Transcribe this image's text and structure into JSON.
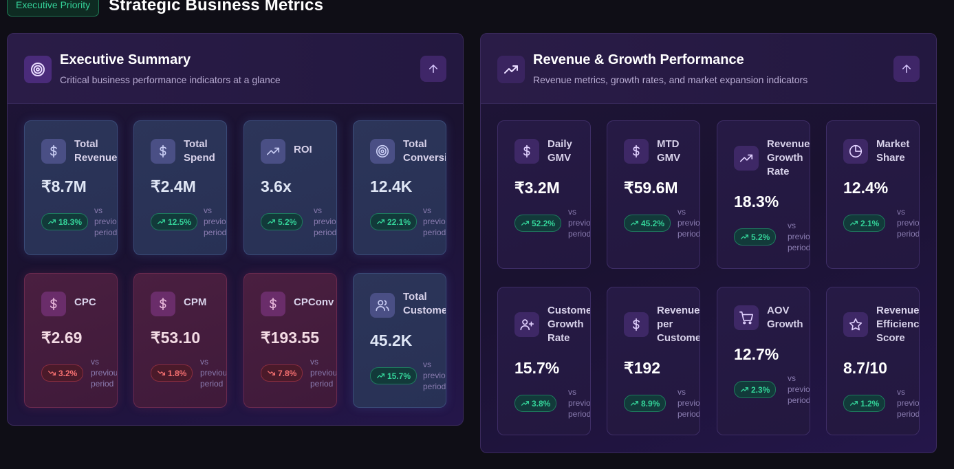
{
  "header": {
    "badge": "Executive Priority",
    "title": "Strategic Business Metrics"
  },
  "vs_text": "vs\nprevious\nperiod",
  "left_panel": {
    "title": "Executive Summary",
    "subtitle": "Critical business performance indicators at a glance",
    "cards": [
      {
        "label": "Total\nRevenue",
        "value": "₹8.7M",
        "change": "18.3%",
        "trend": "up",
        "icon": "dollar-icon",
        "tone": "blue"
      },
      {
        "label": "Total\nSpend",
        "value": "₹2.4M",
        "change": "12.5%",
        "trend": "up",
        "icon": "dollar-icon",
        "tone": "blue"
      },
      {
        "label": "ROI",
        "value": "3.6x",
        "change": "5.2%",
        "trend": "up",
        "icon": "trending-up-icon",
        "tone": "blue"
      },
      {
        "label": "Total\nConversions",
        "value": "12.4K",
        "change": "22.1%",
        "trend": "up",
        "icon": "target-icon",
        "tone": "blue"
      },
      {
        "label": "CPC",
        "value": "₹2.69",
        "change": "3.2%",
        "trend": "down",
        "icon": "dollar-icon",
        "tone": "red"
      },
      {
        "label": "CPM",
        "value": "₹53.10",
        "change": "1.8%",
        "trend": "down",
        "icon": "dollar-icon",
        "tone": "red"
      },
      {
        "label": "CPConv",
        "value": "₹193.55",
        "change": "7.8%",
        "trend": "down",
        "icon": "dollar-icon",
        "tone": "red"
      },
      {
        "label": "Total\nCustomers",
        "value": "45.2K",
        "change": "15.7%",
        "trend": "up",
        "icon": "users-icon",
        "tone": "blue"
      }
    ]
  },
  "right_panel": {
    "title": "Revenue & Growth Performance",
    "subtitle": "Revenue metrics, growth rates, and market expansion indicators",
    "cards": [
      {
        "label": "Daily\nGMV",
        "value": "₹3.2M",
        "change": "52.2%",
        "trend": "up",
        "icon": "dollar-icon",
        "tone": "purple"
      },
      {
        "label": "MTD\nGMV",
        "value": "₹59.6M",
        "change": "45.2%",
        "trend": "up",
        "icon": "dollar-icon",
        "tone": "purple"
      },
      {
        "label": "Revenue\nGrowth\nRate",
        "value": "18.3%",
        "change": "5.2%",
        "trend": "up",
        "icon": "trending-up-icon",
        "tone": "purple"
      },
      {
        "label": "Market\nShare",
        "value": "12.4%",
        "change": "2.1%",
        "trend": "up",
        "icon": "pie-chart-icon",
        "tone": "purple"
      },
      {
        "label": "Customer\nGrowth\nRate",
        "value": "15.7%",
        "change": "3.8%",
        "trend": "up",
        "icon": "user-plus-icon",
        "tone": "purple"
      },
      {
        "label": "Revenue\nper\nCustomer",
        "value": "₹192",
        "change": "8.9%",
        "trend": "up",
        "icon": "dollar-icon",
        "tone": "purple"
      },
      {
        "label": "AOV\nGrowth",
        "value": "12.7%",
        "change": "2.3%",
        "trend": "up",
        "icon": "cart-icon",
        "tone": "purple"
      },
      {
        "label": "Revenue\nEfficiency\nScore",
        "value": "8.7/10",
        "change": "1.2%",
        "trend": "up",
        "icon": "star-icon",
        "tone": "purple"
      }
    ]
  }
}
